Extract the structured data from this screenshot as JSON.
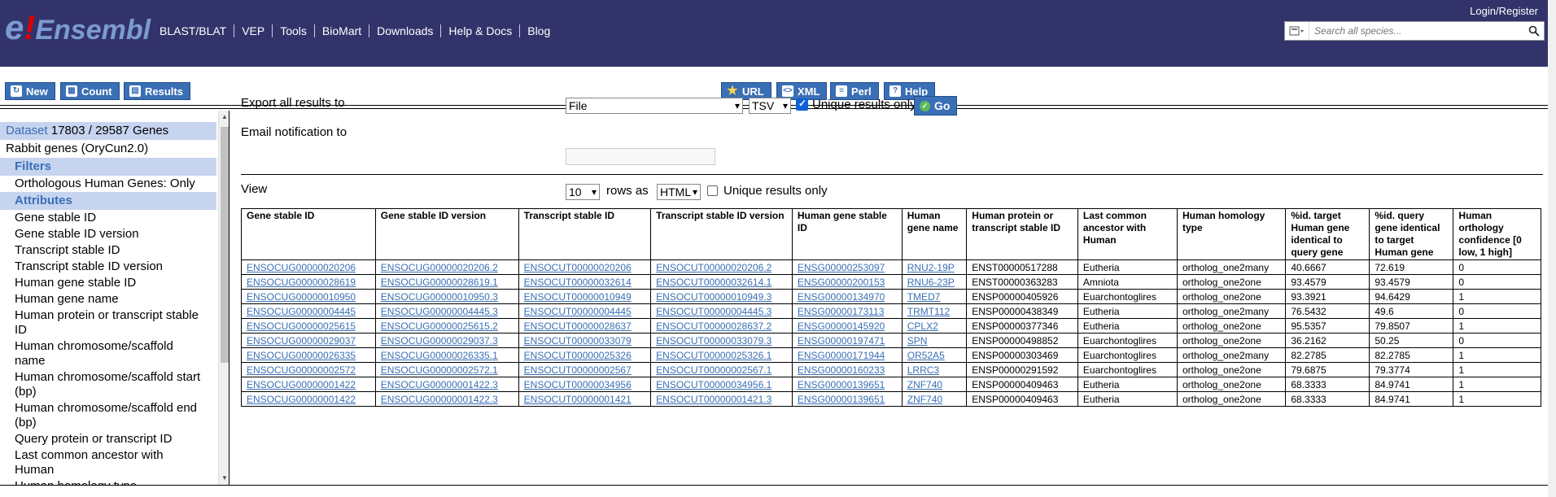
{
  "header": {
    "logo_e": "e",
    "logo_bang": "!",
    "logo_name": "Ensembl",
    "nav": [
      "BLAST/BLAT",
      "VEP",
      "Tools",
      "BioMart",
      "Downloads",
      "Help & Docs",
      "Blog"
    ],
    "login": "Login/Register",
    "search_placeholder": "Search all species..."
  },
  "toolbar": {
    "new": "New",
    "count": "Count",
    "results": "Results",
    "url": "URL",
    "xml": "XML",
    "perl": "Perl",
    "help": "Help"
  },
  "sidebar": {
    "dataset_label": "Dataset",
    "dataset_count": "17803 / 29587 Genes",
    "species": "Rabbit genes (OryCun2.0)",
    "filters_head": "Filters",
    "filter_item": "Orthologous Human Genes: Only",
    "attributes_head": "Attributes",
    "attributes": [
      "Gene stable ID",
      "Gene stable ID version",
      "Transcript stable ID",
      "Transcript stable ID version",
      "Human gene stable ID",
      "Human gene name",
      "Human protein or transcript stable ID",
      "Human chromosome/scaffold name",
      "Human chromosome/scaffold start (bp)",
      "Human chromosome/scaffold end (bp)",
      "Query protein or transcript ID",
      "Last common ancestor with Human",
      "Human homology type"
    ]
  },
  "export": {
    "label": "Export  all results to",
    "dest": "File",
    "format": "TSV",
    "unique_label": "Unique results only",
    "unique_checked": true,
    "go": "Go",
    "email_label": "Email notification to"
  },
  "view": {
    "label": "View",
    "rows": "10",
    "rows_as": "rows as",
    "format": "HTML",
    "unique_label": "Unique results only",
    "unique_checked": false
  },
  "table": {
    "headers": [
      "Gene stable ID",
      "Gene stable ID version",
      "Transcript stable ID",
      "Transcript stable ID version",
      "Human gene stable ID",
      "Human gene name",
      "Human protein or transcript stable ID",
      "Last common ancestor with Human",
      "Human homology type",
      "%id. target Human gene identical to query gene",
      "%id. query gene identical to target Human gene",
      "Human orthology confidence [0 low, 1 high]"
    ],
    "rows": [
      [
        "ENSOCUG00000020206",
        "ENSOCUG00000020206.2",
        "ENSOCUT00000020206",
        "ENSOCUT00000020206.2",
        "ENSG00000253097",
        "RNU2-19P",
        "ENST00000517288",
        "Eutheria",
        "ortholog_one2many",
        "40.6667",
        "72.619",
        "0"
      ],
      [
        "ENSOCUG00000028619",
        "ENSOCUG00000028619.1",
        "ENSOCUT00000032614",
        "ENSOCUT00000032614.1",
        "ENSG00000200153",
        "RNU6-23P",
        "ENST00000363283",
        "Amniota",
        "ortholog_one2one",
        "93.4579",
        "93.4579",
        "0"
      ],
      [
        "ENSOCUG00000010950",
        "ENSOCUG00000010950.3",
        "ENSOCUT00000010949",
        "ENSOCUT00000010949.3",
        "ENSG00000134970",
        "TMED7",
        "ENSP00000405926",
        "Euarchontoglires",
        "ortholog_one2one",
        "93.3921",
        "94.6429",
        "1"
      ],
      [
        "ENSOCUG00000004445",
        "ENSOCUG00000004445.3",
        "ENSOCUT00000004445",
        "ENSOCUT00000004445.3",
        "ENSG00000173113",
        "TRMT112",
        "ENSP00000438349",
        "Eutheria",
        "ortholog_one2many",
        "76.5432",
        "49.6",
        "0"
      ],
      [
        "ENSOCUG00000025615",
        "ENSOCUG00000025615.2",
        "ENSOCUT00000028637",
        "ENSOCUT00000028637.2",
        "ENSG00000145920",
        "CPLX2",
        "ENSP00000377346",
        "Eutheria",
        "ortholog_one2one",
        "95.5357",
        "79.8507",
        "1"
      ],
      [
        "ENSOCUG00000029037",
        "ENSOCUG00000029037.3",
        "ENSOCUT00000033079",
        "ENSOCUT00000033079.3",
        "ENSG00000197471",
        "SPN",
        "ENSP00000498852",
        "Euarchontoglires",
        "ortholog_one2one",
        "36.2162",
        "50.25",
        "0"
      ],
      [
        "ENSOCUG00000026335",
        "ENSOCUG00000026335.1",
        "ENSOCUT00000025326",
        "ENSOCUT00000025326.1",
        "ENSG00000171944",
        "OR52A5",
        "ENSP00000303469",
        "Euarchontoglires",
        "ortholog_one2many",
        "82.2785",
        "82.2785",
        "1"
      ],
      [
        "ENSOCUG00000002572",
        "ENSOCUG00000002572.1",
        "ENSOCUT00000002567",
        "ENSOCUT00000002567.1",
        "ENSG00000160233",
        "LRRC3",
        "ENSP00000291592",
        "Euarchontoglires",
        "ortholog_one2one",
        "79.6875",
        "79.3774",
        "1"
      ],
      [
        "ENSOCUG00000001422",
        "ENSOCUG00000001422.3",
        "ENSOCUT00000034956",
        "ENSOCUT00000034956.1",
        "ENSG00000139651",
        "ZNF740",
        "ENSP00000409463",
        "Eutheria",
        "ortholog_one2one",
        "68.3333",
        "84.9741",
        "1"
      ],
      [
        "ENSOCUG00000001422",
        "ENSOCUG00000001422.3",
        "ENSOCUT00000001421",
        "ENSOCUT00000001421.3",
        "ENSG00000139651",
        "ZNF740",
        "ENSP00000409463",
        "Eutheria",
        "ortholog_one2one",
        "68.3333",
        "84.9741",
        "1"
      ]
    ],
    "link_columns": [
      0,
      1,
      2,
      3,
      4,
      5
    ]
  }
}
